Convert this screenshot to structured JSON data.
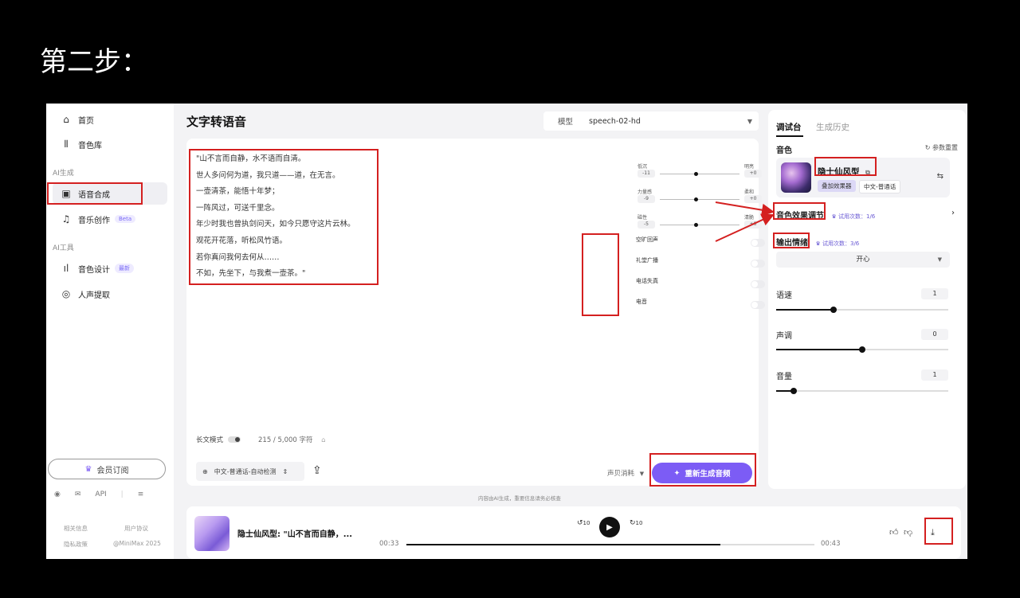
{
  "slide": {
    "title": "第二步："
  },
  "sidebar": {
    "items": [
      {
        "label": "首页",
        "icon": "home-icon"
      },
      {
        "label": "音色库",
        "icon": "library-icon"
      },
      {
        "label": "语音合成",
        "icon": "tts-icon"
      },
      {
        "label": "音乐创作",
        "icon": "music-icon",
        "badge": "Beta"
      },
      {
        "label": "音色设计",
        "icon": "voice-design-icon",
        "badge": "最新"
      },
      {
        "label": "人声提取",
        "icon": "voice-extract-icon"
      }
    ],
    "section_ai_gen": "AI生成",
    "section_ai_tools": "AI工具",
    "vip_label": "会员订阅",
    "api_label": "API",
    "footer": {
      "link1": "相关信息",
      "link2": "用户协议",
      "link3": "隐私政策",
      "copyright": "@MiniMax 2025"
    }
  },
  "main": {
    "title": "文字转语音",
    "model_label": "模型",
    "model_value": "speech-02-hd",
    "poem": [
      "\"山不言而自静，水不语而自清。",
      "世人多问何为道，我只道——道，在无言。",
      "一壶清茶，能悟十年梦；",
      "一阵风过，可送千里念。",
      "年少时我也曾执剑问天，如今只愿守这片云林。",
      "观花开花落，听松风竹语。",
      "若你真问我何去何从……",
      "不如，先坐下，与我煮一壶茶。\""
    ],
    "sliders": [
      {
        "left": "低沉",
        "right": "明亮",
        "left_val": "-11",
        "right_val": "+0"
      },
      {
        "left": "力量感",
        "right": "柔和",
        "left_val": "-9",
        "right_val": "+0"
      },
      {
        "left": "磁性",
        "right": "清脆",
        "left_val": "-5",
        "right_val": "+0"
      }
    ],
    "effects": [
      "空旷回声",
      "礼堂广播",
      "电话失真",
      "电音"
    ],
    "long_mode": "长文模式",
    "char_count": "215 / 5,000 字符",
    "lang_select": "中文-普通话-自动检测",
    "cost_label": "声贝消耗",
    "generate_label": "重新生成音频",
    "disclaimer": "内容由AI生成，重要信息请务必核查"
  },
  "panel": {
    "tab_console": "调试台",
    "tab_history": "生成历史",
    "voice_label": "音色",
    "reset_label": "参数重置",
    "voice_name": "隐士仙风型",
    "tag_effect": "叠加效果器",
    "tag_lang": "中文-普通话",
    "effect_adjust": "音色效果调节",
    "effect_trial": "试用次数：1/6",
    "emotion_label": "输出情绪",
    "emotion_trial": "试用次数：3/6",
    "emotion_value": "开心",
    "speed_label": "语速",
    "speed_value": "1",
    "pitch_label": "声调",
    "pitch_value": "0",
    "volume_label": "音量",
    "volume_value": "1"
  },
  "player": {
    "title": "隐士仙风型: \"山不言而自静，...",
    "time_current": "00:33",
    "time_total": "00:43",
    "skip_back": "10",
    "skip_fwd": "10",
    "progress": 0.77
  }
}
